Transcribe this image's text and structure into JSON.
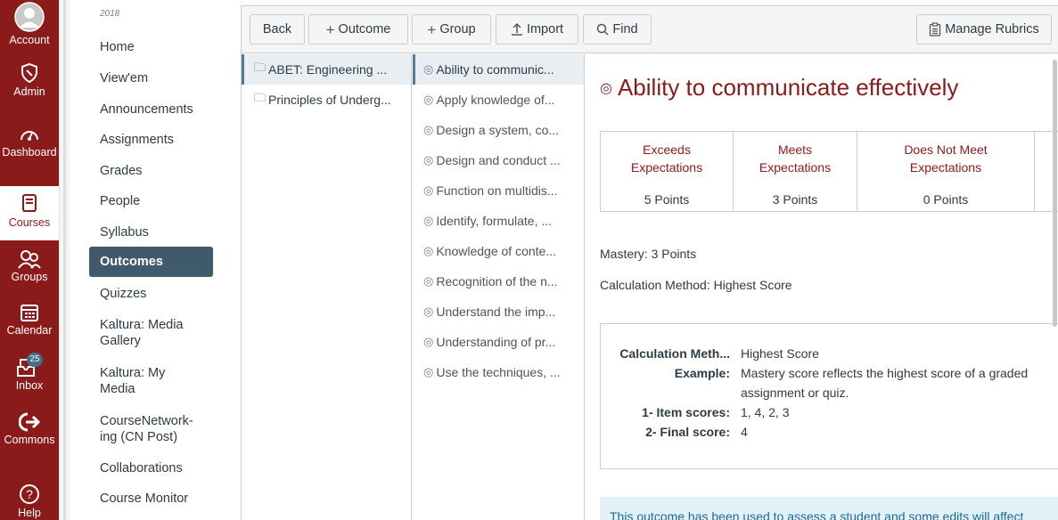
{
  "global_nav": {
    "items": [
      {
        "label": "Account",
        "icon": "account-avatar"
      },
      {
        "label": "Admin",
        "icon": "shield-icon"
      },
      {
        "label": "Dashboard",
        "icon": "dashboard-gauge-icon"
      },
      {
        "label": "Courses",
        "icon": "courses-book-icon"
      },
      {
        "label": "Groups",
        "icon": "groups-icon"
      },
      {
        "label": "Calendar",
        "icon": "calendar-icon"
      },
      {
        "label": "Inbox",
        "icon": "inbox-icon",
        "badge": "25"
      },
      {
        "label": "Commons",
        "icon": "commons-arrow-icon"
      },
      {
        "label": "Help",
        "icon": "help-question-icon"
      }
    ],
    "accent": "#8b1a1a"
  },
  "course_nav": {
    "term": "2018",
    "items": [
      {
        "label": "Home"
      },
      {
        "label": "View'em"
      },
      {
        "label": "Announcements"
      },
      {
        "label": "Assignments"
      },
      {
        "label": "Grades"
      },
      {
        "label": "People"
      },
      {
        "label": "Syllabus"
      },
      {
        "label": "Outcomes",
        "active": true
      },
      {
        "label": "Quizzes"
      },
      {
        "label": "Kaltura: Media Gallery"
      },
      {
        "label": "Kaltura: My Media"
      },
      {
        "label": "CourseNetwork-ing (CN Post)"
      },
      {
        "label": "Collaborations"
      },
      {
        "label": "Course Monitor"
      }
    ]
  },
  "toolbar": {
    "back": "Back",
    "outcome": "Outcome",
    "group": "Group",
    "import": "Import",
    "find": "Find",
    "manage_rubrics": "Manage Rubrics"
  },
  "folders": [
    {
      "label": "ABET: Engineering ...",
      "selected": true
    },
    {
      "label": "Principles of Underg..."
    }
  ],
  "outcomes": [
    {
      "label": "Ability to communic...",
      "selected": true
    },
    {
      "label": "Apply knowledge of..."
    },
    {
      "label": "Design a system, co..."
    },
    {
      "label": "Design and conduct ..."
    },
    {
      "label": "Function on multidis..."
    },
    {
      "label": "Identify, formulate, ..."
    },
    {
      "label": "Knowledge of conte..."
    },
    {
      "label": "Recognition of the n..."
    },
    {
      "label": "Understand the imp..."
    },
    {
      "label": "Understanding of pr..."
    },
    {
      "label": "Use the techniques, ..."
    }
  ],
  "detail": {
    "title": "Ability to communicate effectively",
    "rubric": [
      {
        "line1": "Exceeds",
        "line2": "Expectations",
        "points": "5 Points"
      },
      {
        "line1": "Meets",
        "line2": "Expectations",
        "points": "3 Points"
      },
      {
        "line1": "Does Not Meet",
        "line2": "Expectations",
        "points": "0 Points"
      }
    ],
    "mastery": "Mastery: 3 Points",
    "calc_method_line": "Calculation Method: Highest Score",
    "calc_box": {
      "method_label": "Calculation Meth...",
      "method_value": "Highest Score",
      "example_label": "Example:",
      "example_line1": "Mastery score reflects the highest score of a graded",
      "example_line2": "assignment or quiz.",
      "item_scores_label": "1- Item scores:",
      "item_scores_value": "1, 4, 2, 3",
      "final_score_label": "2- Final score:",
      "final_score_value": "4"
    },
    "notice": "This outcome has been used to assess a student and some edits will affect"
  }
}
